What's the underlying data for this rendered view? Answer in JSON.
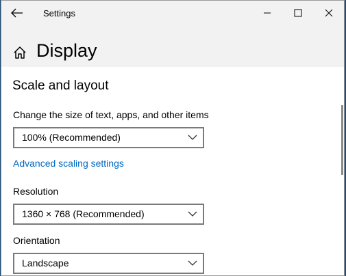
{
  "window": {
    "title": "Settings"
  },
  "header": {
    "page_title": "Display"
  },
  "scale_layout": {
    "section_title": "Scale and layout",
    "size_label": "Change the size of text, apps, and other items",
    "size_value": "100% (Recommended)",
    "advanced_link": "Advanced scaling settings",
    "resolution_label": "Resolution",
    "resolution_value": "1360 × 768 (Recommended)",
    "orientation_label": "Orientation",
    "orientation_value": "Landscape"
  },
  "icons": {
    "back": "back-arrow-icon",
    "home": "home-icon",
    "minimize": "minimize-icon",
    "maximize": "maximize-icon",
    "close": "close-icon",
    "dropdown": "chevron-down-icon"
  },
  "colors": {
    "link": "#0067c0",
    "header_background": "#f2f2f2",
    "content_background": "#ffffff",
    "dropdown_border": "#7a7a7a"
  }
}
